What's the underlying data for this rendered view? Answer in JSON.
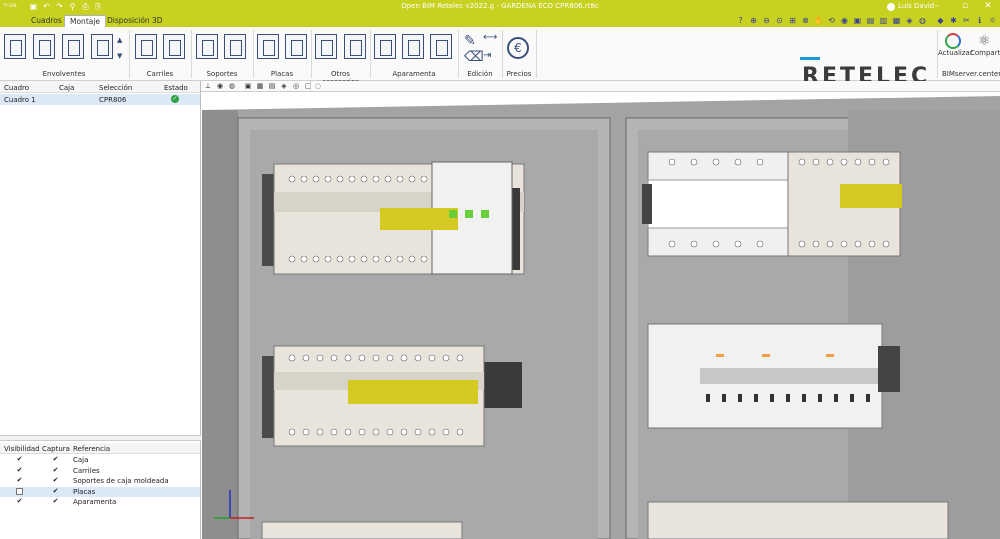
{
  "window": {
    "title": "Open BIM Retelec v2022.g - GARDENA ECO CPR806.rt8c",
    "user": "Luis David",
    "logo_small": "TY·SOL"
  },
  "tabs": [
    {
      "label": "Cuadros"
    },
    {
      "label": "Montaje"
    },
    {
      "label": "Disposición 3D"
    }
  ],
  "ribbon": {
    "groups": [
      {
        "label": "Envolventes"
      },
      {
        "label": "Carriles"
      },
      {
        "label": "Soportes"
      },
      {
        "label": "Placas"
      },
      {
        "label": "Otros accesorios"
      },
      {
        "label": "Aparamenta"
      },
      {
        "label": "Edición"
      },
      {
        "label": "Precios"
      }
    ],
    "brand": "RETELEC",
    "actualizar": "Actualizar",
    "compartir": "Compartir",
    "bimserver": "BIMserver.center"
  },
  "cuadros_table": {
    "headers": [
      "Cuadro",
      "Caja",
      "Selección",
      "Estado"
    ],
    "rows": [
      {
        "cuadro": "Cuadro 1",
        "caja": "",
        "seleccion": "CPR806",
        "estado": "ok"
      }
    ]
  },
  "visibility_table": {
    "headers": [
      "Visibilidad",
      "Captura",
      "Referencia"
    ],
    "rows": [
      {
        "vis": true,
        "cap": true,
        "ref": "Caja"
      },
      {
        "vis": true,
        "cap": true,
        "ref": "Carriles"
      },
      {
        "vis": true,
        "cap": true,
        "ref": "Soportes de caja moldeada"
      },
      {
        "vis": false,
        "cap": true,
        "ref": "Placas"
      },
      {
        "vis": true,
        "cap": true,
        "ref": "Aparamenta"
      }
    ]
  },
  "colors": {
    "accent": "#c7d11f",
    "status_ok": "#2ea043",
    "selection": "#dbe8f6",
    "panel_gray": "#a8a8a8"
  }
}
